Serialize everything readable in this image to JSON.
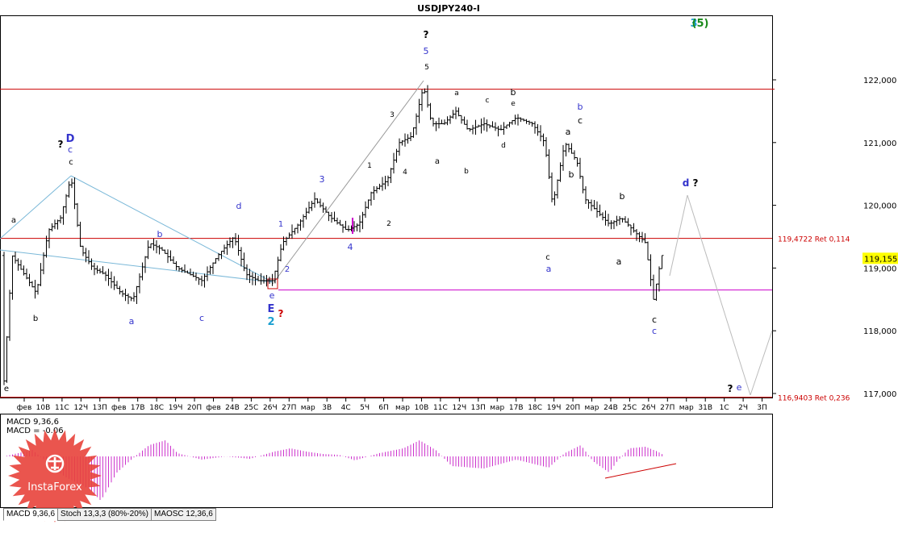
{
  "window": {
    "title": "USDJPY240-I"
  },
  "chart_data": {
    "type": "candlestick",
    "symbol": "USDJPY240-I",
    "ylim": [
      116.84,
      122.25
    ],
    "yticks": [
      "122,000",
      "121,000",
      "120,000",
      "119,000",
      "118,000",
      "117,000"
    ],
    "current_price": "119,155",
    "xticks": [
      "фев",
      "10В",
      "11С",
      "12Ч",
      "13П",
      "фев",
      "17В",
      "18С",
      "19Ч",
      "20П",
      "фев",
      "24В",
      "25С",
      "26Ч",
      "27П",
      "мар",
      "3В",
      "4С",
      "5Ч",
      "6П",
      "мар",
      "10В",
      "11С",
      "12Ч",
      "13П",
      "мар",
      "17В",
      "18С",
      "19Ч",
      "20П",
      "мар",
      "24В",
      "25С",
      "26Ч",
      "27П",
      "мар",
      "31В",
      "1С",
      "2Ч",
      "3П"
    ],
    "levels": [
      {
        "label": "",
        "price": 121.85,
        "color": "#cc0000"
      },
      {
        "label": "119,4722 Ret 0,114",
        "price": 119.472,
        "color": "#cc0000"
      },
      {
        "label": "",
        "price": 118.65,
        "color": "#cc00cc"
      },
      {
        "label": "116,9403 Ret 0,236",
        "price": 116.94,
        "color": "#cc0000"
      }
    ],
    "wave_labels": {
      "top_right_3": "3",
      "top_right_5": "(5)",
      "q": "?",
      "D": "D",
      "c": "c",
      "a": "a",
      "b": "b",
      "d": "d",
      "e": "e",
      "E": "E",
      "n1": "1",
      "n2": "2",
      "n3": "3",
      "n4": "4",
      "n5": "5"
    },
    "macd": {
      "label1": "MACD 9,36,6",
      "label2": "MACD = -0.06"
    }
  },
  "tabs": [
    {
      "label": "MACD 9,36,6"
    },
    {
      "label": "Stoch 13,3,3 (80%-20%)"
    },
    {
      "label": "MAOSC 12,36,6"
    }
  ],
  "logo": {
    "text": "InstaForex",
    "color": "#e8423b"
  }
}
